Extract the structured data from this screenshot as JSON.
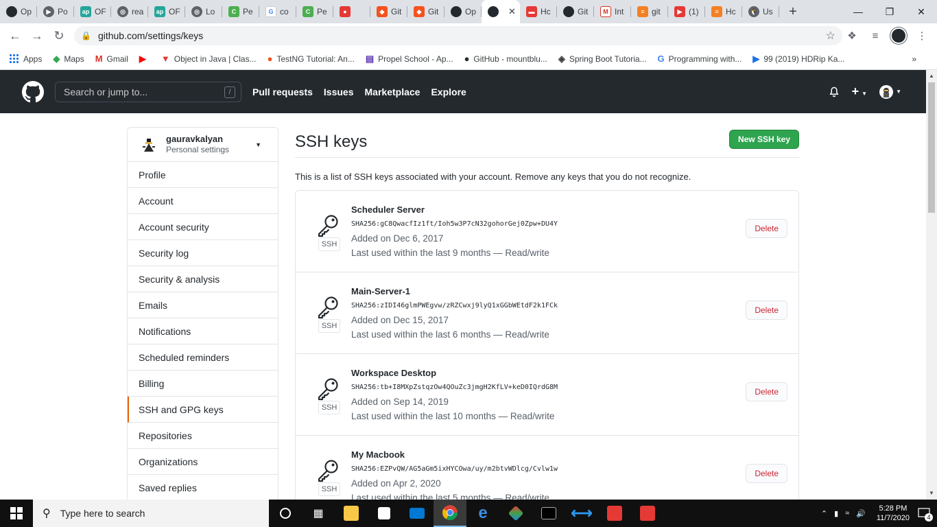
{
  "browser": {
    "tabs": [
      {
        "label": "Op",
        "icon": "github-icon",
        "kind": "gh"
      },
      {
        "label": "Po",
        "icon": "podcast-icon",
        "kind": "gray"
      },
      {
        "label": "OF",
        "icon": "ap-icon",
        "kind": "teal"
      },
      {
        "label": "rea",
        "icon": "globe-icon",
        "kind": "gray"
      },
      {
        "label": "OF",
        "icon": "ap-icon",
        "kind": "teal"
      },
      {
        "label": "Lo",
        "icon": "globe-icon",
        "kind": "gray"
      },
      {
        "label": "Pe",
        "icon": "c-icon",
        "kind": "green"
      },
      {
        "label": "co",
        "icon": "google-icon",
        "kind": "google"
      },
      {
        "label": "Pe",
        "icon": "c-icon",
        "kind": "green"
      },
      {
        "label": "",
        "icon": "record-icon",
        "kind": "red"
      },
      {
        "label": "Git",
        "icon": "git-icon",
        "kind": "orange"
      },
      {
        "label": "Git",
        "icon": "git-icon",
        "kind": "orange"
      },
      {
        "label": "Op",
        "icon": "github-icon",
        "kind": "gh"
      },
      {
        "label": "",
        "icon": "github-icon",
        "kind": "gh",
        "active": true
      },
      {
        "label": "Hc",
        "icon": "flag-icon",
        "kind": "red"
      },
      {
        "label": "Git",
        "icon": "github-icon",
        "kind": "gh"
      },
      {
        "label": "Int",
        "icon": "gmail-icon",
        "kind": "gmail"
      },
      {
        "label": "git",
        "icon": "stackoverflow-icon",
        "kind": "so"
      },
      {
        "label": "(1)",
        "icon": "youtube-icon",
        "kind": "red"
      },
      {
        "label": "Hc",
        "icon": "stackoverflow-icon",
        "kind": "so"
      },
      {
        "label": "Us",
        "icon": "linux-icon",
        "kind": "gray"
      }
    ],
    "new_tab": "+",
    "close_tab": "✕",
    "url": "github.com/settings/keys",
    "bookmarks": [
      {
        "label": "Apps",
        "icon": "apps-icon"
      },
      {
        "label": "Maps",
        "icon": "maps-icon"
      },
      {
        "label": "Gmail",
        "icon": "gmail-icon"
      },
      {
        "label": "",
        "icon": "youtube-icon"
      },
      {
        "label": "Object in Java | Clas...",
        "icon": "javatpoint-icon"
      },
      {
        "label": "TestNG Tutorial: An...",
        "icon": "guru-icon"
      },
      {
        "label": "Propel School - Ap...",
        "icon": "propel-icon"
      },
      {
        "label": "GitHub - mountblu...",
        "icon": "github-icon"
      },
      {
        "label": "Spring Boot Tutoria...",
        "icon": "spring-icon"
      },
      {
        "label": "Programming with...",
        "icon": "google-icon"
      },
      {
        "label": "99 (2019) HDRip Ka...",
        "icon": "play-icon"
      }
    ],
    "bookmarks_more": "»"
  },
  "github": {
    "search_placeholder": "Search or jump to...",
    "search_key": "/",
    "nav": [
      "Pull requests",
      "Issues",
      "Marketplace",
      "Explore"
    ],
    "add_label": "+"
  },
  "sidebar": {
    "username": "gauravkalyan",
    "subtitle": "Personal settings",
    "items": [
      "Profile",
      "Account",
      "Account security",
      "Security log",
      "Security & analysis",
      "Emails",
      "Notifications",
      "Scheduled reminders",
      "Billing",
      "SSH and GPG keys",
      "Repositories",
      "Organizations",
      "Saved replies"
    ],
    "selected": "SSH and GPG keys"
  },
  "main": {
    "title": "SSH keys",
    "new_button": "New SSH key",
    "intro": "This is a list of SSH keys associated with your account. Remove any keys that you do not recognize.",
    "ssh_badge": "SSH",
    "delete_label": "Delete",
    "keys": [
      {
        "title": "Scheduler Server",
        "fingerprint": "SHA256:gC8QwacfIz1ft/Ioh5w3P7cN32gohorGej0Zpw+DU4Y",
        "added": "Added on Dec 6, 2017",
        "used": "Last used within the last 9 months — Read/write"
      },
      {
        "title": "Main-Server-1",
        "fingerprint": "SHA256:zIDI46glmPWEgvw/zRZCwxj9lyQ1xGGbWEtdF2k1FCk",
        "added": "Added on Dec 15, 2017",
        "used": "Last used within the last 6 months — Read/write"
      },
      {
        "title": "Workspace Desktop",
        "fingerprint": "SHA256:tb+I8MXpZstqzOw4QOuZc3jmgH2KfLV+keD0IQrdG8M",
        "added": "Added on Sep 14, 2019",
        "used": "Last used within the last 10 months — Read/write"
      },
      {
        "title": "My Macbook",
        "fingerprint": "SHA256:EZPvQW/AG5aGm5ixHYCOwa/uy/m2btvWDlcg/Cvlw1w",
        "added": "Added on Apr 2, 2020",
        "used": "Last used within the last 5 months — Read/write"
      }
    ]
  },
  "taskbar": {
    "search_placeholder": "Type here to search",
    "time": "5:28 PM",
    "date": "11/7/2020",
    "notification_count": "4"
  }
}
